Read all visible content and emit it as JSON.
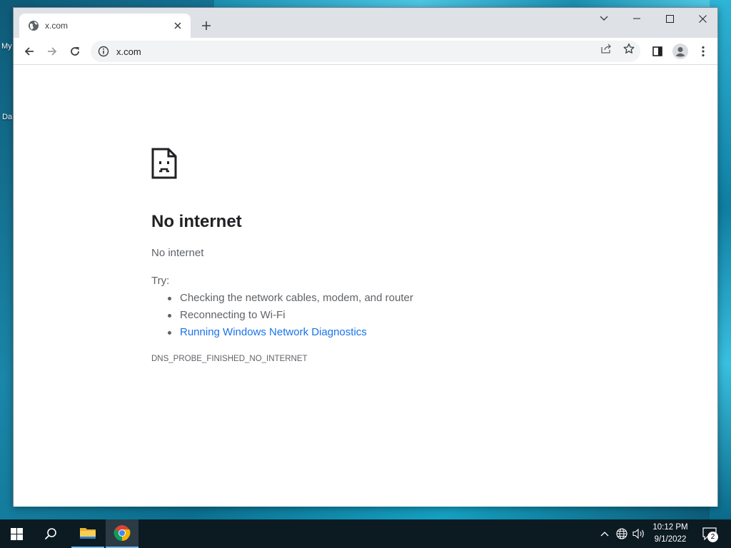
{
  "desktop": {
    "icon_label_1": "My",
    "icon_label_2": "Da"
  },
  "browser": {
    "tab": {
      "title": "x.com"
    },
    "omnibox": {
      "url": "x.com"
    },
    "window_controls": [
      "tab-search",
      "minimize",
      "maximize",
      "close"
    ]
  },
  "error_page": {
    "title": "No internet",
    "subtitle": "No internet",
    "try_label": "Try:",
    "suggestions": [
      "Checking the network cables, modem, and router",
      "Reconnecting to Wi-Fi",
      "Running Windows Network Diagnostics"
    ],
    "error_code": "DNS_PROBE_FINISHED_NO_INTERNET"
  },
  "taskbar": {
    "clock_time": "10:12 PM",
    "clock_date": "9/1/2022",
    "notification_count": "2"
  },
  "colors": {
    "link": "#1a73e8",
    "taskbar": "#0c1a22",
    "tabstrip": "#dee1e6"
  }
}
